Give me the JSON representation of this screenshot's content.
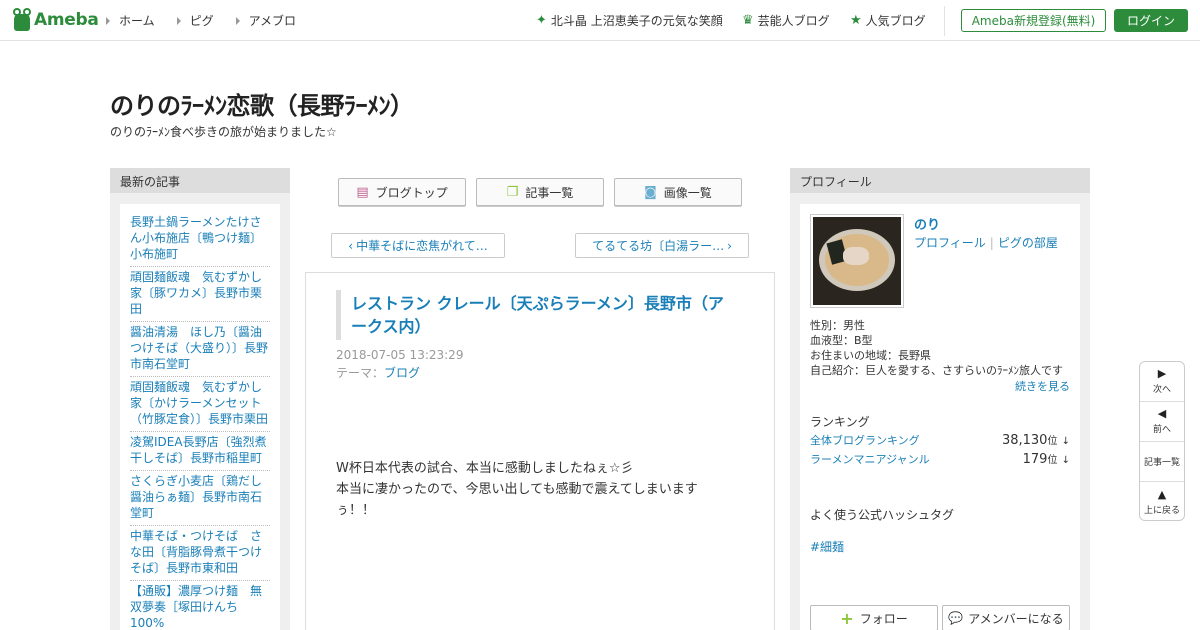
{
  "header": {
    "logo_text": "Ameba",
    "nav": [
      "ホーム",
      "ピグ",
      "アメブロ"
    ],
    "highlights": [
      {
        "icon": "sparkle-icon",
        "label": "北斗晶 上沼恵美子の元気な笑顔"
      },
      {
        "icon": "crown-icon",
        "label": "芸能人ブログ"
      },
      {
        "icon": "star-icon",
        "label": "人気ブログ"
      }
    ],
    "register_label": "Ameba新規登録(無料)",
    "login_label": "ログイン"
  },
  "blog": {
    "title": "のりのﾗｰﾒﾝ恋歌（長野ﾗｰﾒﾝ）",
    "description": "のりのﾗｰﾒﾝ食べ歩きの旅が始まりました☆"
  },
  "left_sidebar": {
    "heading": "最新の記事",
    "items": [
      "長野土鍋ラーメンたけさん小布施店〔鴨つけ麺〕小布施町",
      "頑固麺飯魂　気むずかし家〔豚ワカメ〕長野市栗田",
      "醤油清湯　ほし乃〔醤油つけそば（大盛り）〕長野市南石堂町",
      "頑固麺飯魂　気むずかし家〔かけラーメンセット（竹豚定食）〕長野市栗田",
      "凌駕IDEA長野店〔強烈煮干しそば〕長野市稲里町",
      "さくらぎ小麦店〔鶏だし醤油らぁ麺〕長野市南石堂町",
      "中華そば・つけそば　さな田〔背脂豚骨煮干つけそば〕長野市東和田",
      "【通販】濃厚つけ麺　無双夢奏［塚田けんち100%"
    ]
  },
  "toolbar": {
    "blog_top": "ブログトップ",
    "article_list": "記事一覧",
    "image_list": "画像一覧"
  },
  "pager": {
    "prev": "中華そばに恋焦がれて…",
    "next": "てるてる坊〔白湯ラー…"
  },
  "article": {
    "title": "レストラン クレール〔天ぷらラーメン〕長野市（アークス内）",
    "date": "2018-07-05 13:23:29",
    "theme_label": "テーマ：",
    "theme": "ブログ",
    "body_line1": "W杯日本代表の試合、本当に感動しましたねぇ☆彡",
    "body_line2": "本当に凄かったので、今思い出しても感動で震えてしまいますぅ！！"
  },
  "profile": {
    "heading": "プロフィール",
    "name": "のり",
    "link_profile": "プロフィール",
    "link_pig": "ピグの部屋",
    "gender": "性別：男性",
    "blood": "血液型：B型",
    "area": "お住まいの地域：長野県",
    "intro": "自己紹介：巨人を愛する、さすらいのﾗｰﾒﾝ旅人です",
    "more": "続きを見る",
    "ranking_heading": "ランキング",
    "rankings": [
      {
        "label": "全体ブログランキング",
        "value": "38,130",
        "unit": "位",
        "trend": "↓"
      },
      {
        "label": "ラーメンマニアジャンル",
        "value": "179",
        "unit": "位",
        "trend": "↓"
      }
    ],
    "hashtag_heading": "よく使う公式ハッシュタグ",
    "hashtag": "#細麺",
    "follow_label": "フォロー",
    "amember_label": "アメンバーになる"
  },
  "float_nav": {
    "next": "次へ",
    "prev": "前へ",
    "list": "記事一覧",
    "top": "上に戻る"
  },
  "colors": {
    "brand_green": "#2d8c3c",
    "link_blue": "#1a7fb8"
  }
}
